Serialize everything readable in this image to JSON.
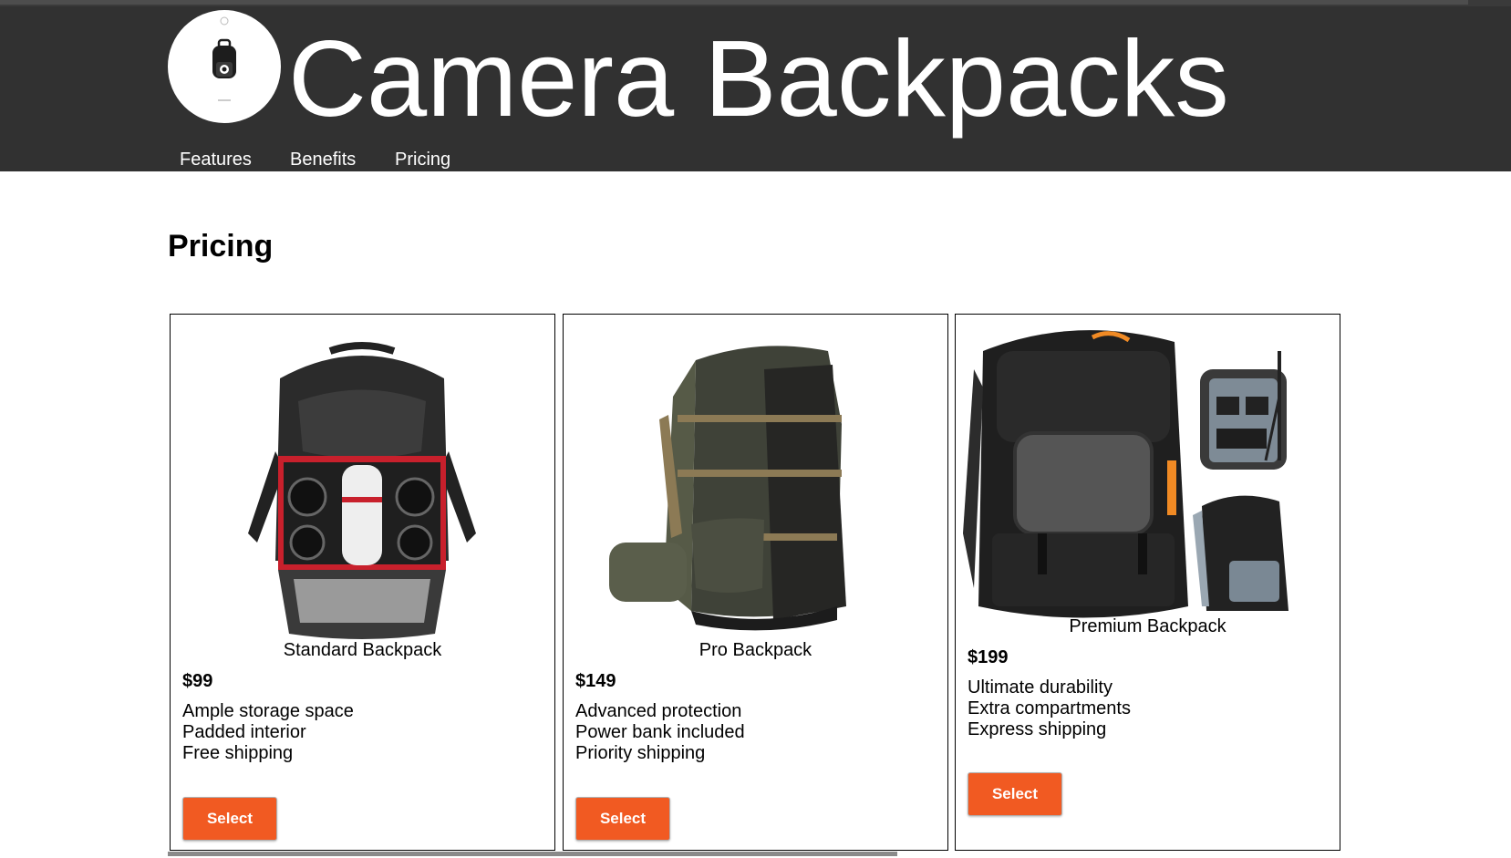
{
  "header": {
    "title": "Camera Backpacks",
    "logo_icon": "backpack-logo-icon",
    "nav": [
      "Features",
      "Benefits",
      "Pricing"
    ]
  },
  "pricing": {
    "heading": "Pricing",
    "accent_color": "#f15a22",
    "plans": [
      {
        "name": "Standard Backpack",
        "price": "$99",
        "features": [
          "Ample storage space",
          "Padded interior",
          "Free shipping"
        ],
        "button": "Select",
        "image_icon": "standard-backpack-image"
      },
      {
        "name": "Pro Backpack",
        "price": "$149",
        "features": [
          "Advanced protection",
          "Power bank included",
          "Priority shipping"
        ],
        "button": "Select",
        "image_icon": "pro-backpack-image"
      },
      {
        "name": "Premium Backpack",
        "price": "$199",
        "features": [
          "Ultimate durability",
          "Extra compartments",
          "Express shipping"
        ],
        "button": "Select",
        "image_icon": "premium-backpack-image"
      }
    ]
  }
}
